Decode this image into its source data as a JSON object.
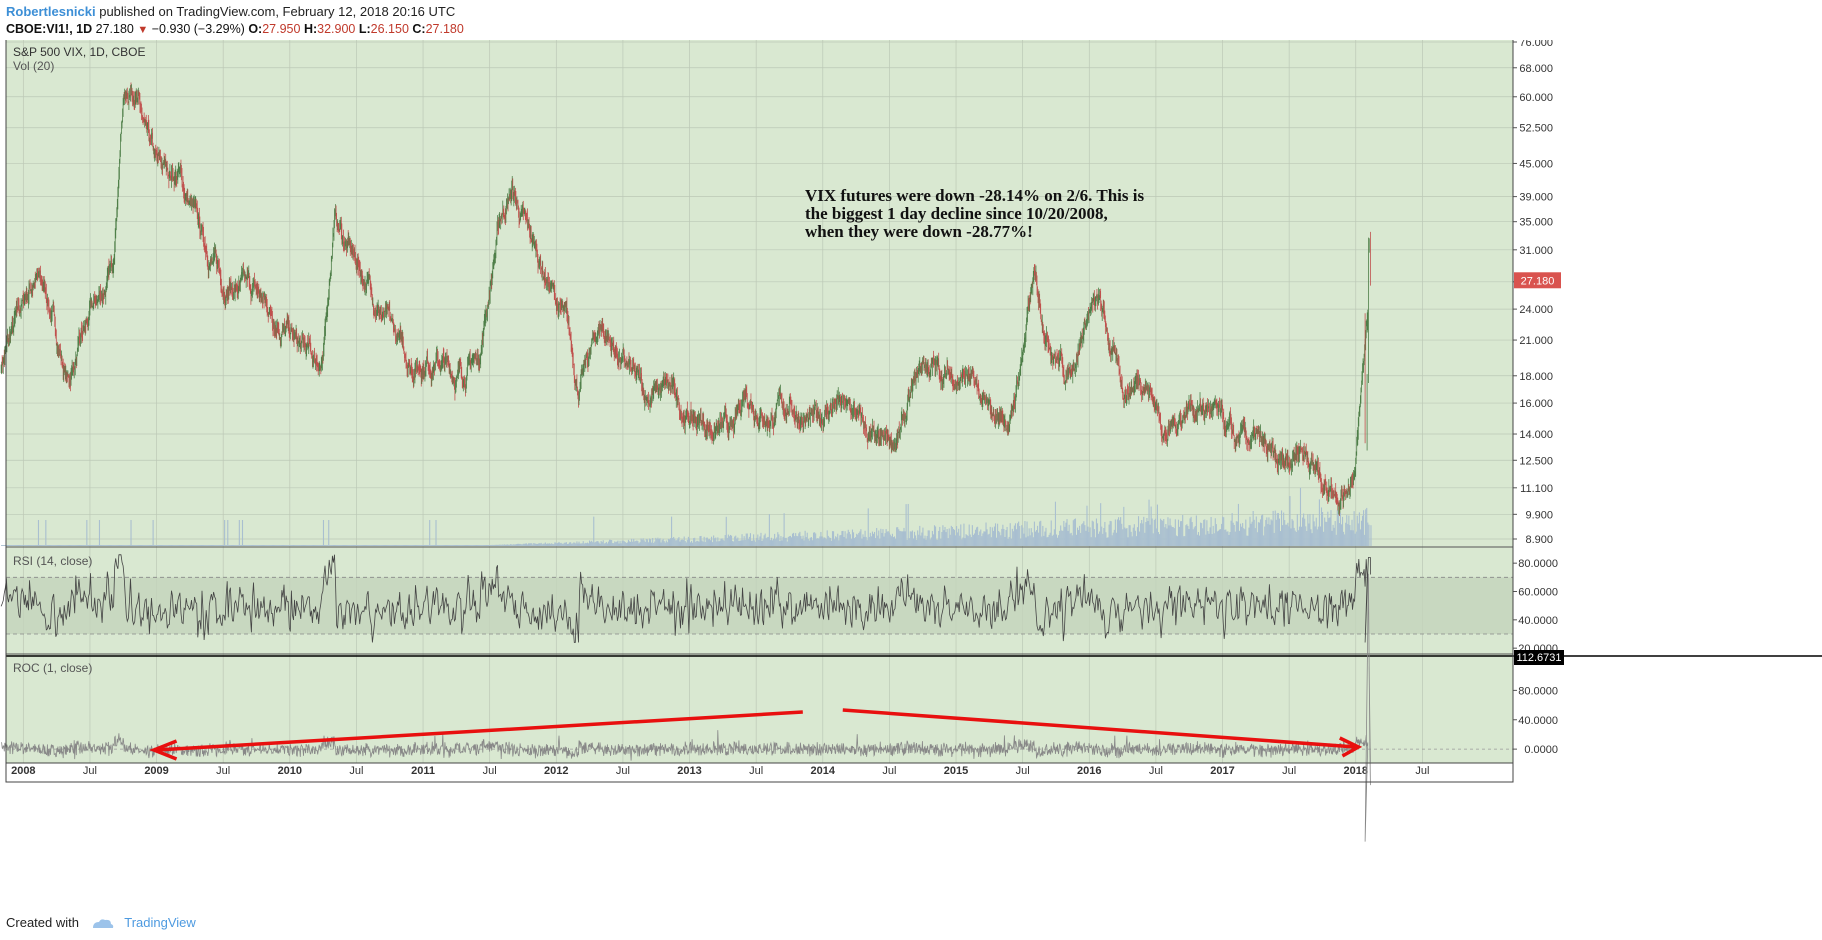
{
  "header": {
    "author": "Robertlesnicki",
    "published_text": "published on TradingView.com, February 12, 2018 20:16 UTC",
    "symbol": "CBOE:VI1!, 1D",
    "last": "27.180",
    "change_arrow": "▼",
    "change": "−0.930 (−3.29%)",
    "open_label": "O:",
    "open": "27.950",
    "high_label": "H:",
    "high": "32.900",
    "low_label": "L:",
    "low": "26.150",
    "close_label": "C:",
    "close": "27.180"
  },
  "footer": {
    "created_with": "Created with",
    "brand": "TradingView"
  },
  "colors": {
    "plot_bg": "#d9e8d1",
    "grid": "#bcc8b6",
    "candle_up": "#4f7f49",
    "candle_down": "#c0504d",
    "volume": "#a9bfd0",
    "rsi_line": "#444444",
    "rsi_band": "#c3d3bc",
    "roc_line": "#888888",
    "annotation_arrow": "#e8100f",
    "price_label_bg": "#d9534f",
    "roc_label_bg": "#000000"
  },
  "chart_data": [
    {
      "type": "candlestick",
      "title": "S&P 500 VIX, 1D, CBOE",
      "subtitle": "Vol (20)",
      "y_scale": "log",
      "y_ticks": [
        "76.000",
        "68.000",
        "60.000",
        "52.500",
        "45.000",
        "39.000",
        "35.000",
        "31.000",
        "27.000",
        "24.000",
        "21.000",
        "18.000",
        "16.000",
        "14.000",
        "12.500",
        "11.100",
        "9.900",
        "8.900"
      ],
      "x_ticks": [
        "2008",
        "Jul",
        "2009",
        "Jul",
        "2010",
        "Jul",
        "2011",
        "Jul",
        "2012",
        "Jul",
        "2013",
        "Jul",
        "2014",
        "Jul",
        "2015",
        "Jul",
        "2016",
        "Jul",
        "2017",
        "Jul",
        "2018",
        "Jul"
      ],
      "x_tick_times": [
        2008.0,
        2008.5,
        2009.0,
        2009.5,
        2010.0,
        2010.5,
        2011.0,
        2011.5,
        2012.0,
        2012.5,
        2013.0,
        2013.5,
        2014.0,
        2014.5,
        2015.0,
        2015.5,
        2016.0,
        2016.5,
        2017.0,
        2017.5,
        2018.0,
        2018.5
      ],
      "last_price_label": "27.180",
      "last_price": 27.18,
      "annotation": [
        "VIX futures were down -28.14% on 2/6. This is",
        "the biggest 1 day decline since 10/20/2008,",
        "when they were down -28.77%!"
      ],
      "key_points": [
        {
          "x": "2007-11",
          "close": 19.0
        },
        {
          "x": "2008-01",
          "close": 24.5
        },
        {
          "x": "2008-02",
          "close": 27.5
        },
        {
          "x": "2008-03",
          "close": 26.0
        },
        {
          "x": "2008-05",
          "close": 17.5
        },
        {
          "x": "2008-07",
          "close": 23.0
        },
        {
          "x": "2008-09",
          "close": 28.0
        },
        {
          "x": "2008-10",
          "close": 60.0
        },
        {
          "x": "2008-11",
          "close": 64.0
        },
        {
          "x": "2008-12",
          "close": 50.0
        },
        {
          "x": "2009-01",
          "close": 44.0
        },
        {
          "x": "2009-03",
          "close": 43.0
        },
        {
          "x": "2009-05",
          "close": 33.0
        },
        {
          "x": "2009-07",
          "close": 27.0
        },
        {
          "x": "2009-10",
          "close": 25.5
        },
        {
          "x": "2009-12",
          "close": 23.0
        },
        {
          "x": "2010-02",
          "close": 20.0
        },
        {
          "x": "2010-04",
          "close": 19.0
        },
        {
          "x": "2010-05",
          "close": 36.0
        },
        {
          "x": "2010-06",
          "close": 32.0
        },
        {
          "x": "2010-08",
          "close": 27.0
        },
        {
          "x": "2010-10",
          "close": 22.0
        },
        {
          "x": "2010-12",
          "close": 19.0
        },
        {
          "x": "2011-02",
          "close": 19.5
        },
        {
          "x": "2011-04",
          "close": 18.0
        },
        {
          "x": "2011-06",
          "close": 19.5
        },
        {
          "x": "2011-08",
          "close": 36.0
        },
        {
          "x": "2011-09",
          "close": 40.0
        },
        {
          "x": "2011-10",
          "close": 35.0
        },
        {
          "x": "2011-12",
          "close": 28.0
        },
        {
          "x": "2012-02",
          "close": 22.0
        },
        {
          "x": "2012-03",
          "close": 17.0
        },
        {
          "x": "2012-05",
          "close": 22.5
        },
        {
          "x": "2012-07",
          "close": 19.0
        },
        {
          "x": "2012-09",
          "close": 16.5
        },
        {
          "x": "2012-11",
          "close": 17.0
        },
        {
          "x": "2013-01",
          "close": 15.0
        },
        {
          "x": "2013-03",
          "close": 14.5
        },
        {
          "x": "2013-05",
          "close": 14.0
        },
        {
          "x": "2013-06",
          "close": 17.0
        },
        {
          "x": "2013-08",
          "close": 15.0
        },
        {
          "x": "2013-10",
          "close": 16.0
        },
        {
          "x": "2013-12",
          "close": 14.5
        },
        {
          "x": "2014-02",
          "close": 16.0
        },
        {
          "x": "2014-04",
          "close": 15.0
        },
        {
          "x": "2014-06",
          "close": 13.0
        },
        {
          "x": "2014-08",
          "close": 14.0
        },
        {
          "x": "2014-10",
          "close": 19.0
        },
        {
          "x": "2014-12",
          "close": 18.0
        },
        {
          "x": "2015-02",
          "close": 18.0
        },
        {
          "x": "2015-04",
          "close": 15.0
        },
        {
          "x": "2015-06",
          "close": 15.0
        },
        {
          "x": "2015-08",
          "close": 27.0
        },
        {
          "x": "2015-09",
          "close": 22.5
        },
        {
          "x": "2015-11",
          "close": 18.0
        },
        {
          "x": "2016-01",
          "close": 24.0
        },
        {
          "x": "2016-02",
          "close": 24.0
        },
        {
          "x": "2016-04",
          "close": 17.0
        },
        {
          "x": "2016-06",
          "close": 18.0
        },
        {
          "x": "2016-08",
          "close": 14.0
        },
        {
          "x": "2016-10",
          "close": 16.0
        },
        {
          "x": "2016-12",
          "close": 15.5
        },
        {
          "x": "2017-02",
          "close": 13.5
        },
        {
          "x": "2017-04",
          "close": 13.5
        },
        {
          "x": "2017-06",
          "close": 12.0
        },
        {
          "x": "2017-08",
          "close": 13.5
        },
        {
          "x": "2017-10",
          "close": 11.5
        },
        {
          "x": "2017-12",
          "close": 11.0
        },
        {
          "x": "2018-01",
          "close": 12.5
        },
        {
          "x": "2018-02",
          "close": 27.18
        }
      ]
    },
    {
      "type": "line",
      "title": "RSI (14, close)",
      "ylim": [
        20,
        90
      ],
      "y_ticks": [
        "80.0000",
        "60.0000",
        "40.0000",
        "20.0000"
      ],
      "bands": [
        30,
        70
      ],
      "last_value": 72.0
    },
    {
      "type": "line",
      "title": "ROC (1, close)",
      "ylim": [
        -10,
        120
      ],
      "y_ticks": [
        "80.0000",
        "40.0000",
        "0.0000"
      ],
      "last_value_label": "112.6731",
      "last_value": 112.6731
    }
  ]
}
